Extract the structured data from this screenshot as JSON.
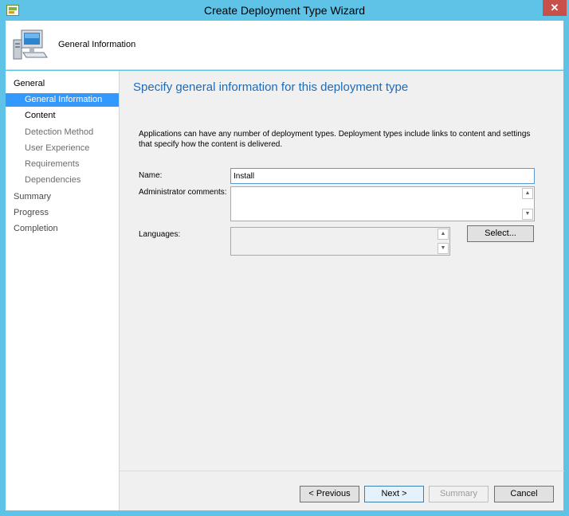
{
  "window": {
    "title": "Create Deployment Type Wizard",
    "close_icon": "close-icon"
  },
  "header": {
    "title": "General Information",
    "icon": "computer-icon"
  },
  "nav": {
    "items": [
      {
        "label": "General",
        "level": "top",
        "state": "normal"
      },
      {
        "label": "General Information",
        "level": "sub",
        "state": "selected"
      },
      {
        "label": "Content",
        "level": "sub",
        "state": "current"
      },
      {
        "label": "Detection Method",
        "level": "sub",
        "state": "normal"
      },
      {
        "label": "User Experience",
        "level": "sub",
        "state": "normal"
      },
      {
        "label": "Requirements",
        "level": "sub",
        "state": "normal"
      },
      {
        "label": "Dependencies",
        "level": "sub",
        "state": "normal"
      },
      {
        "label": "Summary",
        "level": "top",
        "state": "normal"
      },
      {
        "label": "Progress",
        "level": "top",
        "state": "normal"
      },
      {
        "label": "Completion",
        "level": "top",
        "state": "normal"
      }
    ]
  },
  "main": {
    "heading": "Specify general information for this deployment type",
    "description": "Applications can have any number of deployment types. Deployment types include links to content and settings that specify how the content is delivered.",
    "name_label": "Name:",
    "name_value": "Install",
    "comments_label": "Administrator comments:",
    "comments_value": "",
    "languages_label": "Languages:",
    "select_button": "Select..."
  },
  "footer": {
    "previous": "< Previous",
    "next": "Next >",
    "summary": "Summary",
    "cancel": "Cancel"
  },
  "colors": {
    "titlebar": "#5ec3e6",
    "accent": "#1e6bb5",
    "selected": "#3399ff",
    "close": "#c7504b"
  }
}
